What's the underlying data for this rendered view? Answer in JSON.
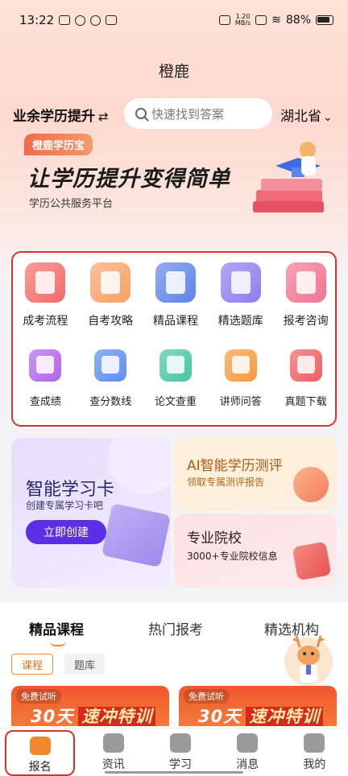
{
  "status_bar": {
    "time": "13:22",
    "net_speed": "1.20\nMB/s",
    "battery": "88%"
  },
  "page": {
    "title": "橙鹿"
  },
  "topbar": {
    "category": "业余学历提升",
    "search_placeholder": "快速找到答案",
    "province": "湖北省"
  },
  "banner": {
    "tag": "橙鹿学历宝",
    "slogan": "让学历提升变得简单",
    "subline": "学历公共服务平台"
  },
  "services": {
    "row1": [
      {
        "label": "成考流程",
        "color": "#f46a6a"
      },
      {
        "label": "自考攻略",
        "color": "#f7a065"
      },
      {
        "label": "精品课程",
        "color": "#5d84e8"
      },
      {
        "label": "精选题库",
        "color": "#8e7cf0"
      },
      {
        "label": "报考咨询",
        "color": "#f27390"
      }
    ],
    "row2": [
      {
        "label": "查成绩",
        "color": "#b064e8"
      },
      {
        "label": "查分数线",
        "color": "#5b8df0"
      },
      {
        "label": "论文查重",
        "color": "#47c6a0"
      },
      {
        "label": "讲师问答",
        "color": "#f7983e"
      },
      {
        "label": "真题下载",
        "color": "#ef5d62"
      }
    ]
  },
  "cards": {
    "study_card": {
      "title": "智能学习卡",
      "subtitle": "创建专属学习卡吧",
      "button": "立即创建"
    },
    "ai_eval": {
      "title": "AI智能学历测评",
      "subtitle": "领取专属测评报告"
    },
    "schools": {
      "title": "专业院校",
      "subtitle": "3000+专业院校信息"
    }
  },
  "tabs": [
    "精品课程",
    "热门报考",
    "精选机构"
  ],
  "chips": [
    "课程",
    "题库"
  ],
  "courses": [
    {
      "free": "免费试听",
      "title_a": "30天",
      "title_b": "速冲特训"
    },
    {
      "free": "免费试听",
      "title_a": "30天",
      "title_b": "速冲特训"
    }
  ],
  "bottom_nav": [
    "报名",
    "资讯",
    "学习",
    "消息",
    "我的"
  ],
  "colors": {
    "accent": "#f08a2c",
    "highlight": "#d9312c",
    "primary_button": "#5b2fe6"
  }
}
